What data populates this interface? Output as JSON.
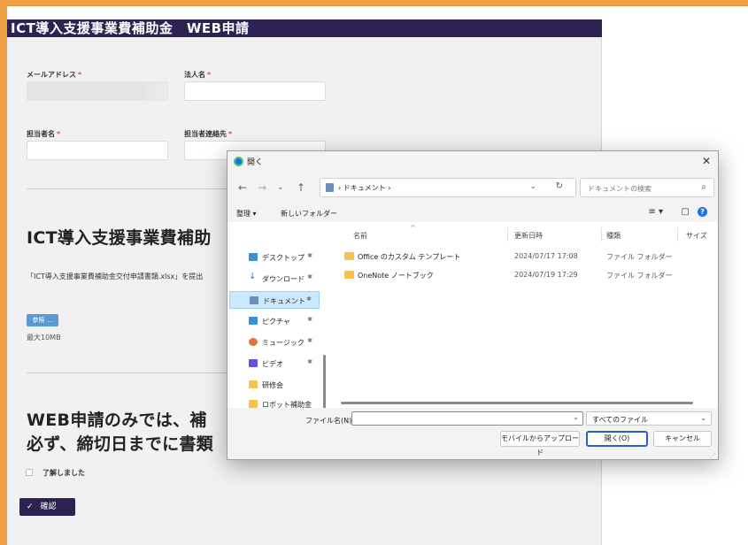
{
  "page": {
    "title": "ICT導入支援事業費補助金　WEB申請",
    "form": {
      "email_label": "メールアドレス",
      "company_label": "法人名",
      "person_label": "担当者名",
      "contact_label": "担当者連絡先",
      "required_mark": "*",
      "section1_title": "ICT導入支援事業費補助",
      "section1_text": "「ICT導入支援事業費補助金交付申請書類.xlsx」を提出",
      "browse_label": "参照 ...",
      "max_size": "最大10MB",
      "section2_line1": "WEB申請のみでは、補",
      "section2_line2": "必ず、締切日までに書類",
      "agree_label": "了解しました",
      "confirm_label": "確認",
      "confirm_icon": "check-icon"
    }
  },
  "dialog": {
    "title": "開く",
    "address_path": "› ドキュメント ›",
    "search_placeholder": "ドキュメントの検索",
    "toolbar": {
      "organize": "整理 ▾",
      "new_folder": "新しいフォルダー"
    },
    "sidebar": [
      {
        "label": "デスクトップ",
        "icon": "desktop-icon",
        "color": "#3a8fd8",
        "pinned": true
      },
      {
        "label": "ダウンロード",
        "icon": "download-icon",
        "color": "#2b7bd8",
        "pinned": true
      },
      {
        "label": "ドキュメント",
        "icon": "documents-icon",
        "color": "#6b8fb8",
        "pinned": true,
        "selected": true
      },
      {
        "label": "ピクチャ",
        "icon": "pictures-icon",
        "color": "#3a8fd8",
        "pinned": true
      },
      {
        "label": "ミュージック",
        "icon": "music-icon",
        "color": "#e2733b",
        "pinned": true
      },
      {
        "label": "ビデオ",
        "icon": "video-icon",
        "color": "#6b4fd8",
        "pinned": true
      },
      {
        "label": "研修会",
        "icon": "folder-icon",
        "color": "#f6c24f",
        "pinned": false
      },
      {
        "label": "ロボット補助金",
        "icon": "folder-icon",
        "color": "#f6c24f",
        "pinned": false
      }
    ],
    "columns": {
      "name": "名前",
      "modified": "更新日時",
      "type": "種類",
      "size": "サイズ"
    },
    "files": [
      {
        "name": "Office のカスタム テンプレート",
        "modified": "2024/07/17 17:08",
        "type": "ファイル フォルダー"
      },
      {
        "name": "OneNote ノートブック",
        "modified": "2024/07/19 17:29",
        "type": "ファイル フォルダー"
      }
    ],
    "filename_label": "ファイル名(N):",
    "filename_value": "",
    "filetype_value": "すべてのファイル",
    "upload_mobile": "モバイルからアップロード",
    "open_button": "開く(O)",
    "cancel_button": "キャンセル"
  }
}
